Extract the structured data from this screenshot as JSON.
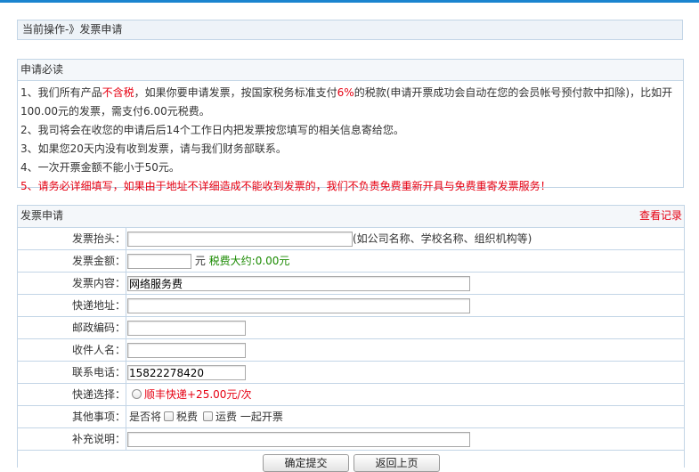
{
  "breadcrumb": "当前操作-》发票申请",
  "notice": {
    "title": "申请必读",
    "line1_a": "1、我们所有产品",
    "line1_red": "不含税",
    "line1_b": "，如果你要申请发票，按国家税务标准支付",
    "line1_rate": "6%",
    "line1_c": "的税款(申请开票成功会自动在您的会员帐号预付款中扣除)，比如开",
    "line1_d": "100.00元的发票，需支付6.00元税费。",
    "line2": "2、我司将会在收您的申请后后14个工作日内把发票按您填写的相关信息寄给您。",
    "line3": "3、如果您20天内没有收到发票，请与我们财务部联系。",
    "line4": "4、一次开票金额不能小于50元。",
    "line5": "5、请务必详细填写，如果由于地址不详细造成不能收到发票的，我们不负责免费重新开具与免费重寄发票服务！"
  },
  "form": {
    "title": "发票申请",
    "view_records": "查看记录",
    "invoice_title_label": "发票抬头：",
    "invoice_title_value": "",
    "invoice_title_hint": "(如公司名称、学校名称、组织机构等)",
    "amount_label": "发票金额：",
    "amount_value": "",
    "amount_unit": "元",
    "tax_estimate": "税费大约:0.00元",
    "content_label": "发票内容：",
    "content_value": "网络服务费",
    "address_label": "快递地址：",
    "address_value": "",
    "postcode_label": "邮政编码：",
    "postcode_value": "",
    "recipient_label": "收件人名：",
    "recipient_value": "",
    "phone_label": "联系电话：",
    "phone_value": "15822278420",
    "express_label": "快递选择：",
    "express_option": "顺丰快递+25.00元/次",
    "other_label": "其他事项：",
    "other_prefix": "是否将",
    "other_tax": "税费",
    "other_shipping": "运费",
    "other_suffix": "一起开票",
    "remark_label": "补充说明：",
    "remark_value": ""
  },
  "buttons": {
    "submit": "确定提交",
    "back": "返回上页"
  },
  "colors": {
    "accent_bar": "#1a84cf",
    "border": "#c3d5e6",
    "warning_red": "#e60012",
    "tax_green": "#1a8a00"
  }
}
